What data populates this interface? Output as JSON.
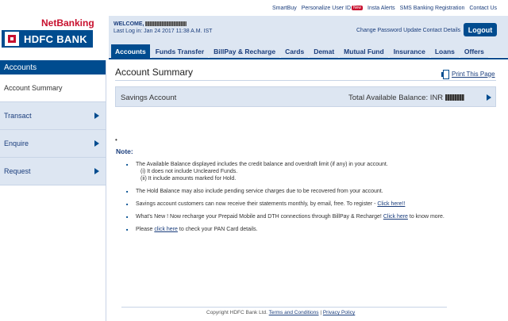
{
  "utility_links": [
    {
      "label": "SmartBuy"
    },
    {
      "label": "Personalize User ID",
      "badge": "New"
    },
    {
      "label": "Insta Alerts"
    },
    {
      "label": "SMS Banking Registration"
    },
    {
      "label": "Contact Us"
    }
  ],
  "brand": {
    "netbanking": "NetBanking",
    "bank_name": "HDFC BANK"
  },
  "header": {
    "welcome": "WELCOME,",
    "last_login": "Last Log in: Jan 24 2017 11:38 A.M. IST",
    "change_password": "Change Password",
    "update_contact": "Update Contact Details",
    "logout": "Logout"
  },
  "nav": {
    "tabs": [
      {
        "label": "Accounts"
      },
      {
        "label": "Funds Transfer"
      },
      {
        "label": "BillPay & Recharge"
      },
      {
        "label": "Cards"
      },
      {
        "label": "Demat"
      },
      {
        "label": "Mutual Fund"
      },
      {
        "label": "Insurance"
      },
      {
        "label": "Loans"
      },
      {
        "label": "Offers"
      }
    ]
  },
  "sidebar": {
    "heading": "Accounts",
    "items": [
      {
        "label": "Account Summary"
      },
      {
        "label": "Transact"
      },
      {
        "label": "Enquire"
      },
      {
        "label": "Request"
      }
    ]
  },
  "main": {
    "title": "Account Summary",
    "print_label": "Print This Page",
    "savings_label": "Savings Account",
    "balance_label": "Total Available Balance: INR",
    "bullet": "•",
    "note_heading": "Note:",
    "notes": {
      "n1_main": "The Available Balance displayed includes the credit balance and overdraft limit (if any) in your account.",
      "n1_sub1": "(i) It does not include Uncleared Funds.",
      "n1_sub2": "(ii) It include amounts marked for Hold.",
      "n2": "The Hold Balance may also include pending service charges due to be recovered from your account.",
      "n3_text": "Savings account customers can now receive their statements monthly, by email, free. To register - ",
      "n3_link": "Click here!!",
      "n4_text": "What's New ! Now recharge your Prepaid Mobile and DTH connections through BillPay & Recharge! ",
      "n4_link": "Click here",
      "n4_tail": " to know more.",
      "n5_pre": "Please ",
      "n5_link": "click here",
      "n5_tail": " to check your PAN Card details."
    }
  },
  "footer": {
    "copyright": "Copyright HDFC Bank Ltd.",
    "terms": "Terms and Conditions",
    "sep": " | ",
    "privacy": "Privacy Policy"
  },
  "colors": {
    "brand_blue": "#004c8f",
    "brand_red": "#c8102e",
    "light_blue": "#dde6f2"
  }
}
